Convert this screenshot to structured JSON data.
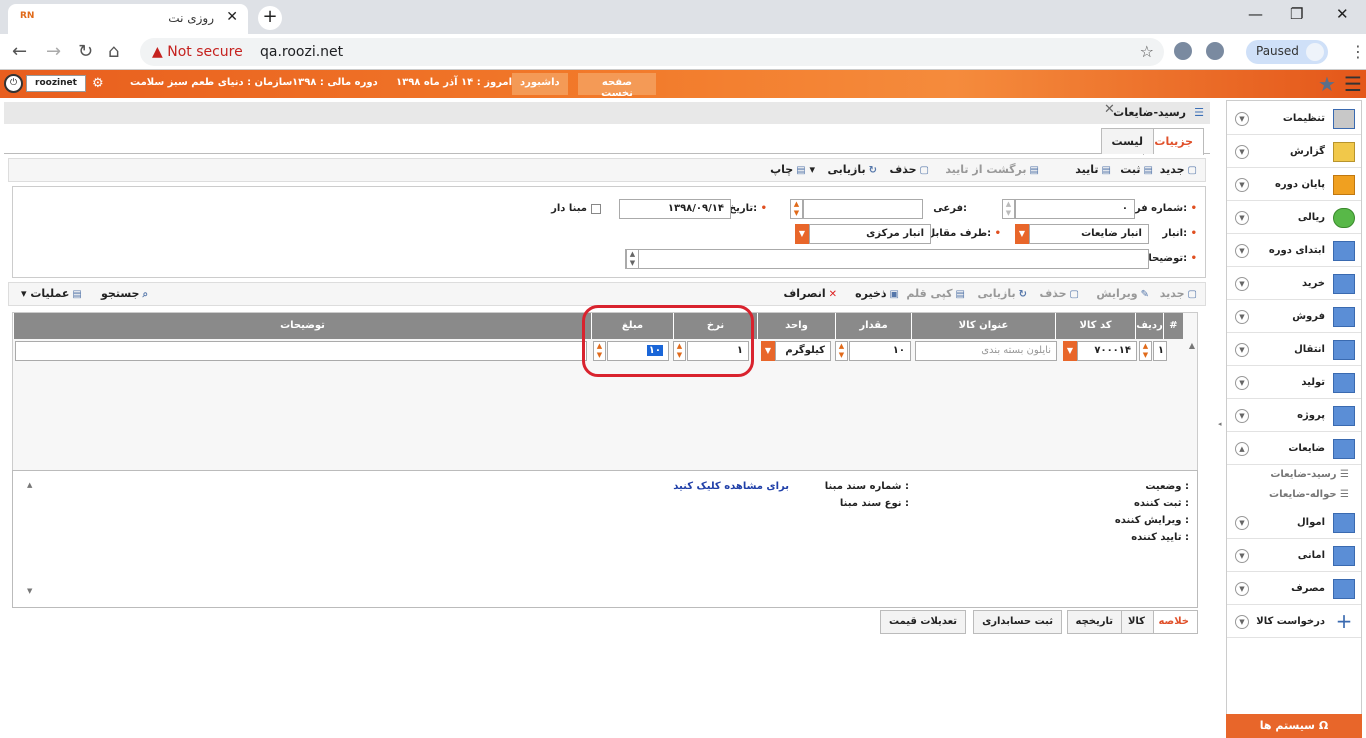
{
  "browser": {
    "tab_title": "روزی نت",
    "tab_favicon": "RN",
    "not_secure": "Not secure",
    "url": "qa.roozi.net",
    "profile_status": "Paused"
  },
  "topbar": {
    "username": "roozinet",
    "org_label": "سازمان :",
    "org_value": "دنیای طعم سبز سلامت",
    "period_label": "دوره مالی :",
    "period_value": "۱۳۹۸",
    "today_label": "امروز :",
    "today_value": "۱۴ آذر ماه ۱۳۹۸",
    "dashboard": "داشبورد",
    "home": "صفحه نخست"
  },
  "page": {
    "title": "رسید-ضایعات",
    "tab_details": "جزییات",
    "tab_list": "لیست"
  },
  "toolbar": {
    "new": "جدید",
    "save": "ثبت",
    "approve": "تایید",
    "unapprove": "برگشت از تایید",
    "delete": "حذف",
    "refresh": "بازیابی",
    "print": "چاپ"
  },
  "form": {
    "form_no_label": "شماره فرم:",
    "form_no_value": "۰",
    "sub_label": "فرعی:",
    "sub_value": "",
    "date_label": "تاریخ:",
    "date_value": "۱۳۹۸/۰۹/۱۴",
    "based_label": "مبنا دار",
    "warehouse_label": "انبار:",
    "warehouse_value": "انبار ضایعات",
    "counterparty_label": "طرف مقابل:",
    "counterparty_value": "انبار مرکزی",
    "desc_label": "توضیحات:",
    "desc_value": ""
  },
  "toolbar2": {
    "new": "جدید",
    "edit": "ویرایش",
    "delete": "حذف",
    "refresh": "بازیابی",
    "copy": "کپی قلم",
    "save": "ذخیره",
    "cancel": "انصراف",
    "search": "جستجو",
    "operations": "عملیات"
  },
  "grid": {
    "columns": [
      "#",
      "ردیف",
      "کد کالا",
      "عنوان کالا",
      "مقدار",
      "واحد",
      "نرخ",
      "مبلغ",
      "توضیحات"
    ],
    "row": {
      "index": "۱",
      "code": "۷۰۰۰۱۴",
      "title_placeholder": "نایلون بسته بندی",
      "qty": "۱۰",
      "unit": "کیلوگرم",
      "rate": "۱",
      "amount": "۱۰",
      "desc": ""
    }
  },
  "info": {
    "status_label": "وضعیت :",
    "creator_label": "ثبت کننده :",
    "editor_label": "ویرایش کننده :",
    "approver_label": "تایید کننده :",
    "base_doc_no_label": "شماره سند مبنا :",
    "base_doc_type_label": "نوع سند مبنا :",
    "view_link": "برای مشاهده کلیک کنید"
  },
  "bottom_tabs": [
    "خلاصه",
    "کالا",
    "تاریخچه",
    "ثبت حسابداری",
    "تعدیلات قیمت"
  ],
  "sidebar": {
    "items": [
      {
        "label": "تنظیمات",
        "icon": "settings-icon"
      },
      {
        "label": "گزارش",
        "icon": "report-icon"
      },
      {
        "label": "پایان دوره",
        "icon": "period-end-icon"
      },
      {
        "label": "ریالی",
        "icon": "money-icon"
      },
      {
        "label": "ابتدای دوره",
        "icon": "table-icon"
      },
      {
        "label": "خرید",
        "icon": "table-icon"
      },
      {
        "label": "فروش",
        "icon": "table-icon"
      },
      {
        "label": "انتقال",
        "icon": "table-icon"
      },
      {
        "label": "تولید",
        "icon": "table-icon"
      },
      {
        "label": "پروژه",
        "icon": "table-icon"
      },
      {
        "label": "ضایعات",
        "icon": "table-icon"
      }
    ],
    "subitems": [
      "رسید-ضایعات",
      "حواله-ضایعات"
    ],
    "items2": [
      {
        "label": "اموال",
        "icon": "table-icon"
      },
      {
        "label": "امانی",
        "icon": "table-icon"
      },
      {
        "label": "مصرف",
        "icon": "table-icon"
      },
      {
        "label": "درخواست کالا",
        "icon": "plus-icon"
      }
    ],
    "system_button": "سیستم ها"
  },
  "colors": {
    "accent": "#e8662a",
    "grid_header": "#8a8a8a",
    "link": "#1f3fa8",
    "highlight": "#d9232e"
  }
}
